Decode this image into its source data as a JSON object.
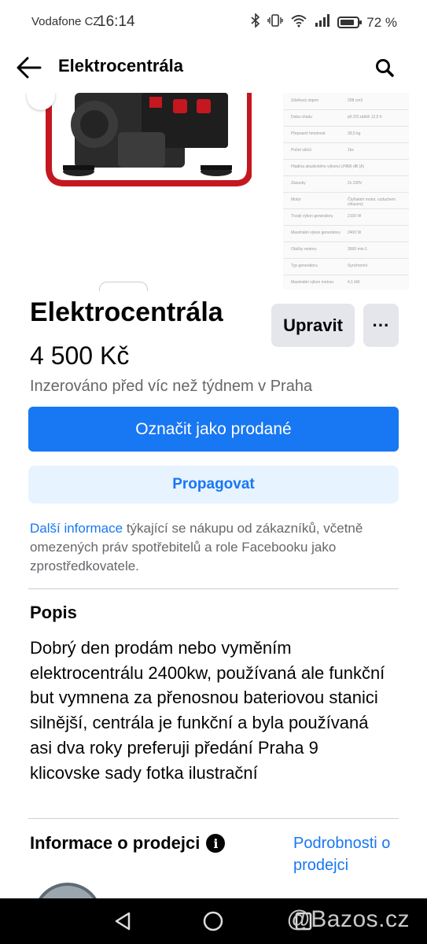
{
  "status_bar": {
    "carrier": "Vodafone CZ",
    "time": "16:14",
    "battery": "72 %"
  },
  "header": {
    "title": "Elektrocentrála",
    "back_icon": "arrow-left-icon",
    "search_icon": "search-icon"
  },
  "listing": {
    "title": "Elektrocentrála",
    "edit_label": "Upravit",
    "more_label": "···",
    "price": "4 500 Kč",
    "posted": "Inzerováno před víc než týdnem v Praha",
    "mark_sold_label": "Označit jako prodané",
    "promote_label": "Propagovat",
    "info_link": "Další informace",
    "info_rest": " týkající se nákupu od zákazníků, včetně omezených práv spotřebitelů a role Facebooku jako zprostředkovatele."
  },
  "description": {
    "heading": "Popis",
    "body": "Dobrý den prodám nebo vyměním elektrocentrálu 2400kw, používaná ale funkční  but vymnena za přenosnou bateriovou stanici silnější, centrála je funkční a byla používaná asi dva roky preferuji předání Praha 9 klicovske sady fotka ilustrační"
  },
  "seller": {
    "heading": "Informace o prodejci",
    "details_link": "Podrobnosti o prodejci"
  },
  "spec_table": [
    [
      "Zdvihový objem",
      "208 cm3"
    ],
    [
      "Doba chodu",
      "při 2/3 zátěži 12,5 h"
    ],
    [
      "Přepravní hmotnost",
      "39,5 kg"
    ],
    [
      "Počet válců",
      "1ks"
    ],
    [
      "Hladina akustického výkonu LPA",
      "96 dB (A)"
    ],
    [
      "Zásuvky",
      "2x 230V"
    ],
    [
      "Motor",
      "Čtyřtaktní motor, vzduchem chlazený"
    ],
    [
      "Trvalý výkon generátoru",
      "2100 W"
    ],
    [
      "Maximální výkon generátoru",
      "2400 W"
    ],
    [
      "Otáčky motoru",
      "3000 min-1"
    ],
    [
      "Typ generátoru",
      "Synchronní"
    ],
    [
      "Maximální výkon motoru",
      "4,1 kW"
    ]
  ],
  "watermark": "@Bazos.cz",
  "colors": {
    "accent": "#1877f2",
    "accent_light": "#e7f3ff",
    "secondary_button": "#e4e6eb",
    "muted_text": "#65676b"
  }
}
